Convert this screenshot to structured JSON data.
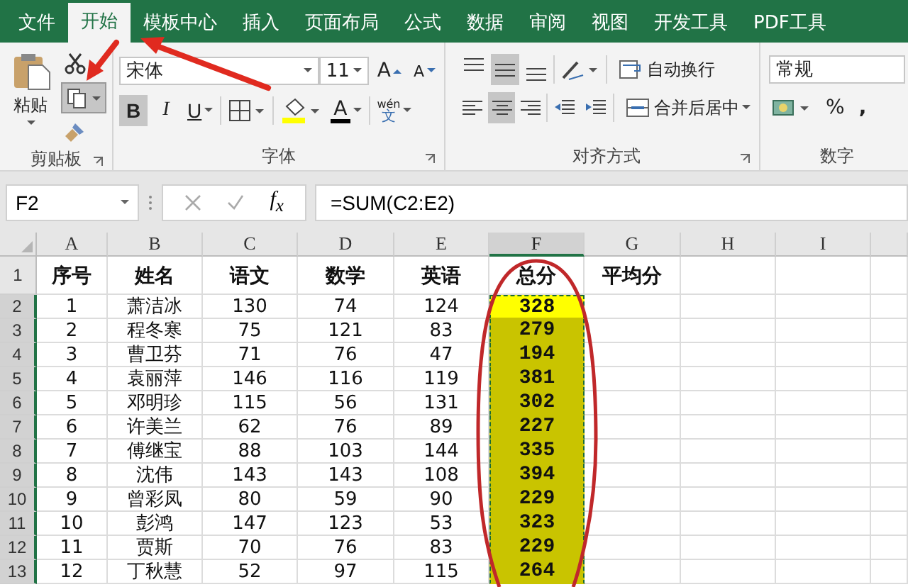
{
  "tabs": [
    {
      "label": "文件",
      "selected": false
    },
    {
      "label": "开始",
      "selected": true
    },
    {
      "label": "模板中心",
      "selected": false
    },
    {
      "label": "插入",
      "selected": false
    },
    {
      "label": "页面布局",
      "selected": false
    },
    {
      "label": "公式",
      "selected": false
    },
    {
      "label": "数据",
      "selected": false
    },
    {
      "label": "审阅",
      "selected": false
    },
    {
      "label": "视图",
      "selected": false
    },
    {
      "label": "开发工具",
      "selected": false
    },
    {
      "label": "PDF工具",
      "selected": false
    }
  ],
  "ribbon": {
    "clipboard": {
      "paste": "粘贴",
      "copy_selected": true,
      "label": "剪贴板"
    },
    "font": {
      "font_name": "宋体",
      "font_size": "11",
      "grow": "A",
      "shrink": "A",
      "bold": {
        "text": "B",
        "on": true
      },
      "italic": {
        "text": "I",
        "on": false
      },
      "underline": {
        "text": "U",
        "on": false
      },
      "font_color": "A",
      "phonetic": "wén",
      "phonetic_char": "文",
      "label": "字体"
    },
    "alignment": {
      "vertical": [
        {
          "kind": "top",
          "selected": false
        },
        {
          "kind": "middle",
          "selected": true
        },
        {
          "kind": "bottom",
          "selected": false
        }
      ],
      "horizontal": [
        {
          "kind": "left",
          "selected": false
        },
        {
          "kind": "center",
          "selected": true
        },
        {
          "kind": "right",
          "selected": false
        }
      ],
      "wrap_text": "自动换行",
      "merge": "合并后居中",
      "label": "对齐方式"
    },
    "number": {
      "format": "常规",
      "percent": "%",
      "comma": ",",
      "label": "数字"
    }
  },
  "formula_bar": {
    "name_box": "F2",
    "function_label": "f$_{x}$",
    "formula": "=SUM(C2:E2)"
  },
  "sheet": {
    "columns": [
      {
        "label": "A",
        "selected": false
      },
      {
        "label": "B",
        "selected": false
      },
      {
        "label": "C",
        "selected": false
      },
      {
        "label": "D",
        "selected": false
      },
      {
        "label": "E",
        "selected": false
      },
      {
        "label": "F",
        "selected": true
      },
      {
        "label": "G",
        "selected": false
      },
      {
        "label": "H",
        "selected": false
      },
      {
        "label": "I",
        "selected": false
      }
    ],
    "rows": [
      {
        "header": "1",
        "selected": false,
        "active": false,
        "cells": [
          "序号",
          "姓名",
          "语文",
          "数学",
          "英语",
          "总分",
          "平均分"
        ]
      },
      {
        "header": "2",
        "selected": true,
        "active": true,
        "cells": [
          "1",
          "萧洁冰",
          "130",
          "74",
          "124",
          "328"
        ]
      },
      {
        "header": "3",
        "selected": true,
        "active": false,
        "cells": [
          "2",
          "程冬寒",
          "75",
          "121",
          "83",
          "279"
        ]
      },
      {
        "header": "4",
        "selected": true,
        "active": false,
        "cells": [
          "3",
          "曹卫芬",
          "71",
          "76",
          "47",
          "194"
        ]
      },
      {
        "header": "5",
        "selected": true,
        "active": false,
        "cells": [
          "4",
          "袁丽萍",
          "146",
          "116",
          "119",
          "381"
        ]
      },
      {
        "header": "6",
        "selected": true,
        "active": false,
        "cells": [
          "5",
          "邓明珍",
          "115",
          "56",
          "131",
          "302"
        ]
      },
      {
        "header": "7",
        "selected": true,
        "active": false,
        "cells": [
          "6",
          "许美兰",
          "62",
          "76",
          "89",
          "227"
        ]
      },
      {
        "header": "8",
        "selected": true,
        "active": false,
        "cells": [
          "7",
          "傅继宝",
          "88",
          "103",
          "144",
          "335"
        ]
      },
      {
        "header": "9",
        "selected": true,
        "active": false,
        "cells": [
          "8",
          "沈伟",
          "143",
          "143",
          "108",
          "394"
        ]
      },
      {
        "header": "10",
        "selected": true,
        "active": false,
        "cells": [
          "9",
          "曾彩凤",
          "80",
          "59",
          "90",
          "229"
        ]
      },
      {
        "header": "11",
        "selected": true,
        "active": false,
        "cells": [
          "10",
          "彭鸿",
          "147",
          "123",
          "53",
          "323"
        ]
      },
      {
        "header": "12",
        "selected": true,
        "active": false,
        "cells": [
          "11",
          "贾斯",
          "70",
          "76",
          "83",
          "229"
        ]
      },
      {
        "header": "13",
        "selected": true,
        "active": false,
        "cells": [
          "12",
          "丁秋慧",
          "52",
          "97",
          "115",
          "264"
        ]
      }
    ]
  }
}
